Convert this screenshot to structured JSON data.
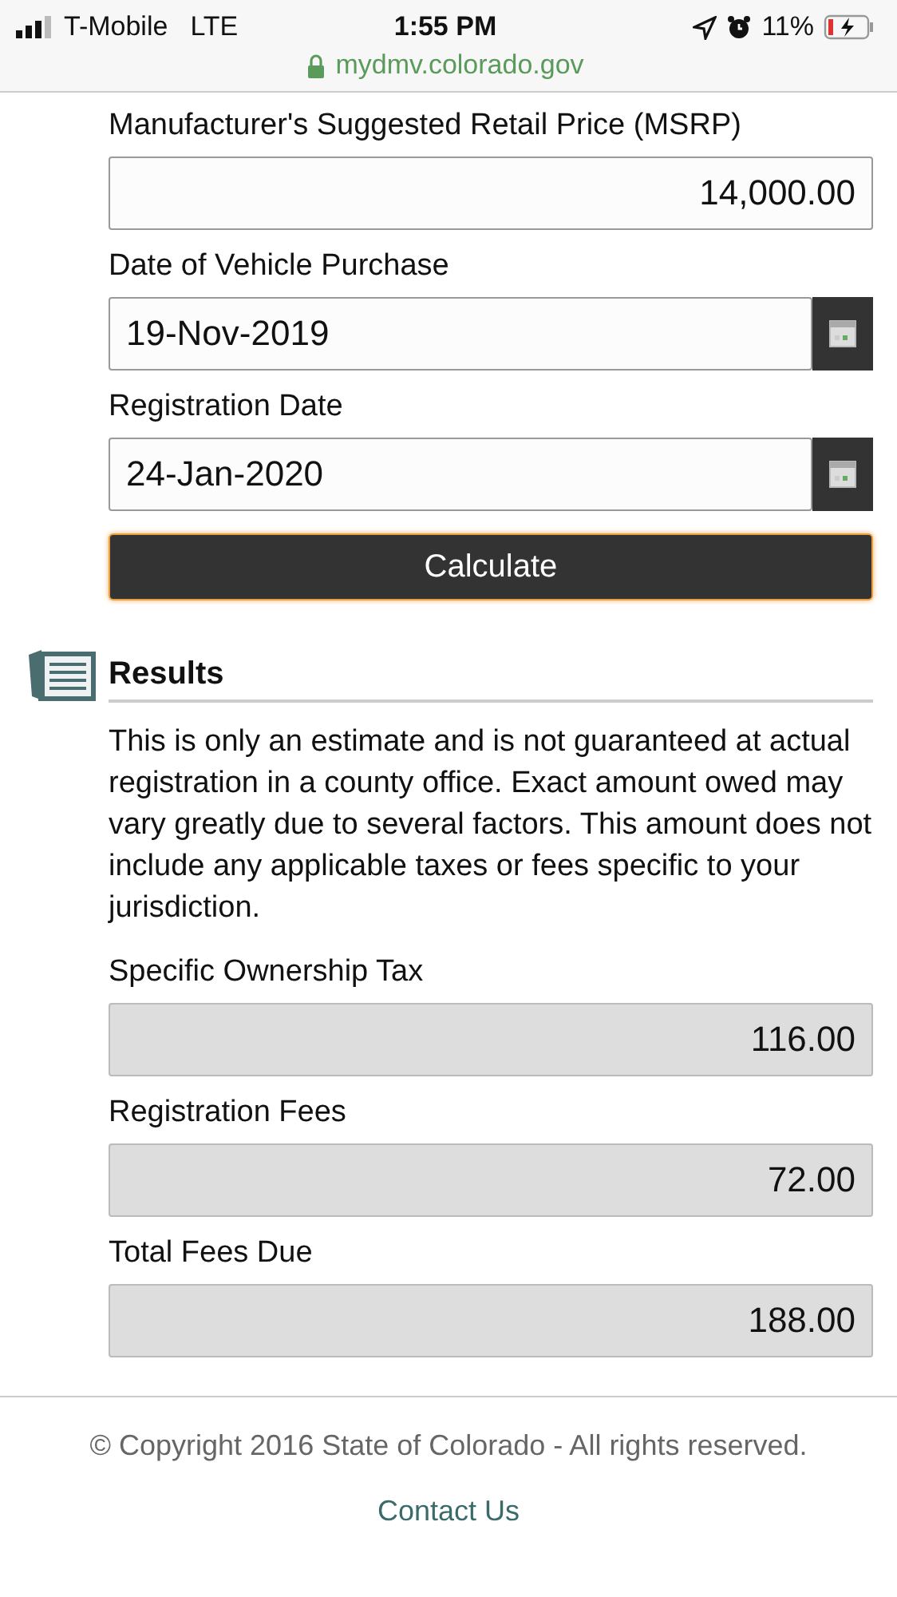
{
  "status_bar": {
    "carrier": "T-Mobile",
    "network": "LTE",
    "time": "1:55 PM",
    "battery": "11%"
  },
  "address_bar": {
    "url": "mydmv.colorado.gov"
  },
  "inputs": [
    {
      "label": "Manufacturer's Suggested Retail Price (MSRP)",
      "value": "14,000.00",
      "kind": "number"
    },
    {
      "label": "Date of Vehicle Purchase",
      "value": "19-Nov-2019",
      "kind": "date"
    },
    {
      "label": "Registration Date",
      "value": "24-Jan-2020",
      "kind": "date"
    }
  ],
  "calculate_button": "Calculate",
  "results": {
    "title": "Results",
    "note": "This is only an estimate and is not guaranteed at actual registration in a county office. Exact amount owed may vary greatly due to several factors. This amount does not include any applicable taxes or fees specific to your jurisdiction.",
    "fields": [
      {
        "label": "Specific Ownership Tax",
        "value": "116.00"
      },
      {
        "label": "Registration Fees",
        "value": "72.00"
      },
      {
        "label": "Total Fees Due",
        "value": "188.00"
      }
    ]
  },
  "footer": {
    "copyright": "© Copyright 2016 State of Colorado - All rights reserved.",
    "link": "Contact Us"
  }
}
